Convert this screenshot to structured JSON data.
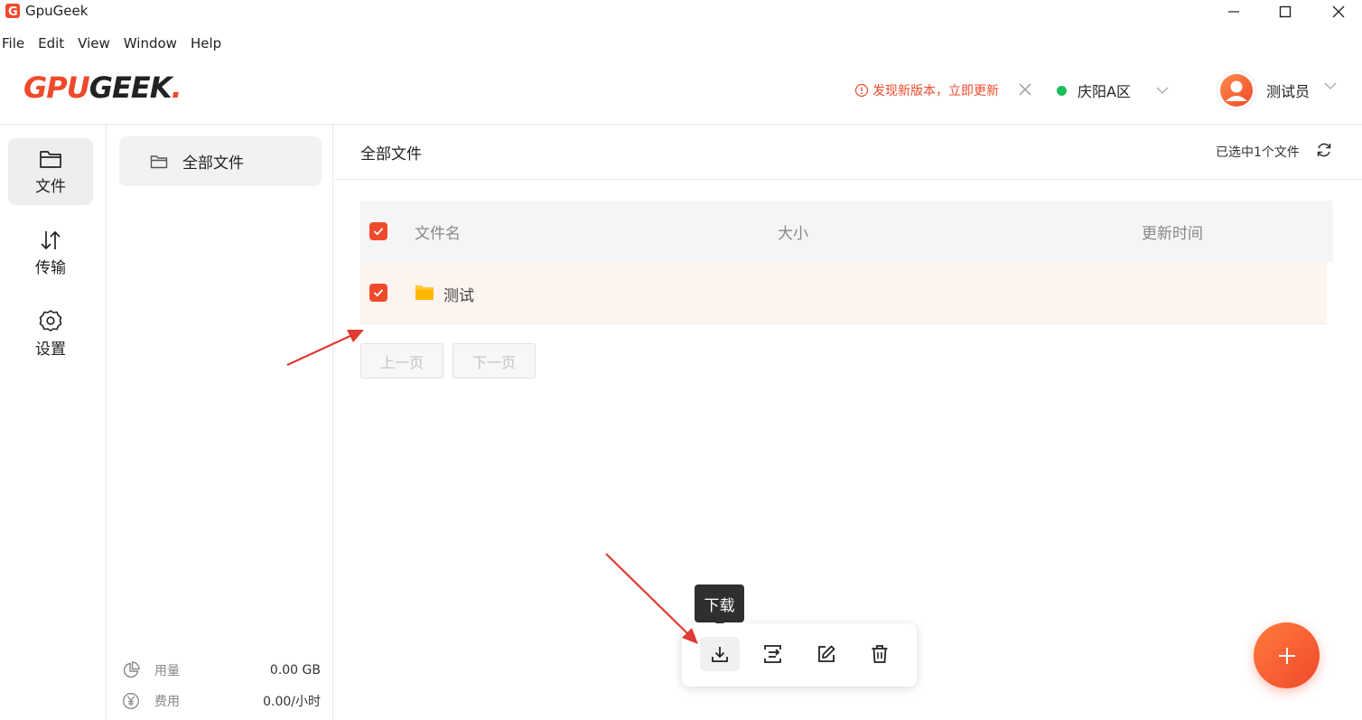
{
  "window": {
    "title": "GpuGeek"
  },
  "menu": [
    "File",
    "Edit",
    "View",
    "Window",
    "Help"
  ],
  "brand": {
    "part1": "GPU",
    "part2": "GEEK",
    "dot": ".",
    "accent": "#f04a2c"
  },
  "header": {
    "update_notice": "发现新版本，立即更新",
    "region": "庆阳A区",
    "region_status_color": "#1bbf5a",
    "user": "测试员"
  },
  "nav": [
    {
      "label": "文件",
      "icon": "folder-icon"
    },
    {
      "label": "传输",
      "icon": "transfer-icon"
    },
    {
      "label": "设置",
      "icon": "gear-icon"
    }
  ],
  "side_panel": {
    "all_files": "全部文件",
    "usage_label": "用量",
    "usage_value": "0.00 GB",
    "cost_label": "费用",
    "cost_value": "0.00/小时"
  },
  "main": {
    "title": "全部文件",
    "selected_text": "已选中1个文件",
    "columns": {
      "name": "文件名",
      "size": "大小",
      "updated": "更新时间"
    },
    "rows": [
      {
        "name": "测试",
        "size": "",
        "updated": "",
        "type": "folder",
        "checked": true
      }
    ],
    "prev_page": "上一页",
    "next_page": "下一页"
  },
  "toolbar": {
    "tooltip": "下载",
    "tools": [
      "download-icon",
      "move-icon",
      "edit-icon",
      "delete-icon"
    ]
  }
}
